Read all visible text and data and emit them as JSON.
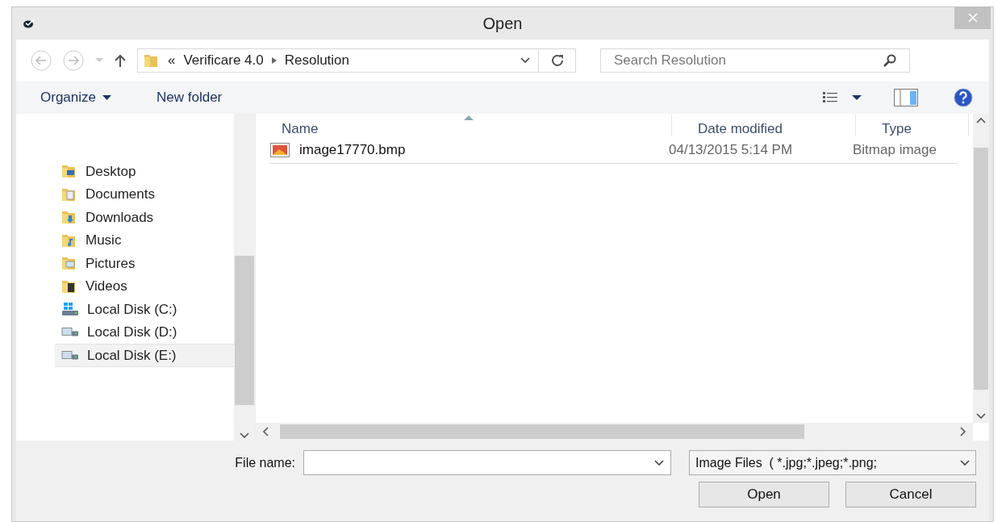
{
  "window": {
    "title": "Open"
  },
  "address": {
    "path": [
      {
        "label": "«"
      },
      {
        "label": "Verificare 4.0"
      },
      {
        "label": "Resolution"
      }
    ]
  },
  "search": {
    "placeholder": "Search Resolution"
  },
  "toolbar": {
    "organize": "Organize",
    "new_folder": "New folder"
  },
  "sidebar": {
    "items": [
      {
        "label": "Desktop",
        "kind": "desktop",
        "selected": false
      },
      {
        "label": "Documents",
        "kind": "documents",
        "selected": false
      },
      {
        "label": "Downloads",
        "kind": "downloads",
        "selected": false
      },
      {
        "label": "Music",
        "kind": "music",
        "selected": false
      },
      {
        "label": "Pictures",
        "kind": "pictures",
        "selected": false
      },
      {
        "label": "Videos",
        "kind": "videos",
        "selected": false
      },
      {
        "label": "Local Disk (C:)",
        "kind": "system-drive",
        "selected": false
      },
      {
        "label": "Local Disk (D:)",
        "kind": "drive",
        "selected": false
      },
      {
        "label": "Local Disk (E:)",
        "kind": "drive",
        "selected": true
      }
    ]
  },
  "table": {
    "columns": [
      "Name",
      "Date modified",
      "Type"
    ],
    "rows": [
      {
        "name": "image17770.bmp",
        "date": "04/13/2015 5:14 PM",
        "type": "Bitmap image",
        "selected": false
      }
    ]
  },
  "footer": {
    "file_name_label": "File name:",
    "file_type": "Image Files  ( *.jpg;*.jpeg;*.png;",
    "buttons": [
      "Open",
      "Cancel"
    ]
  }
}
